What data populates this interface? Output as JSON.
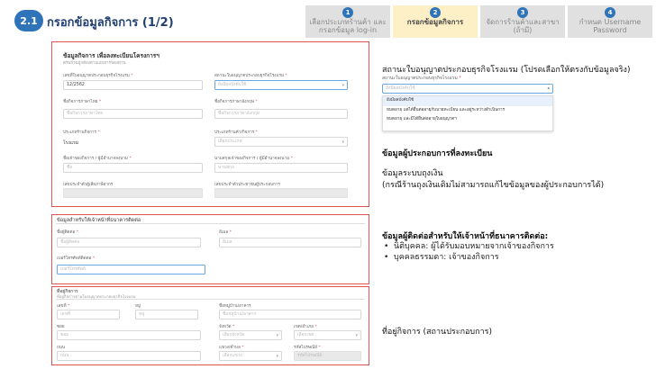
{
  "header": {
    "step_badge": "2.1",
    "title": "กรอกข้อมูลกิจการ (1/2)",
    "steps": [
      {
        "num": "1",
        "label": "เลือกประเภทร้านค้า และกรอกข้อมูล log-in"
      },
      {
        "num": "2",
        "label": "กรอกข้อมูลกิจการ"
      },
      {
        "num": "3",
        "label": "จัดการร้านค้าและสาขา (ถ้ามี)"
      },
      {
        "num": "4",
        "label": "กำหนด Username Password"
      }
    ]
  },
  "form_business": {
    "title": "ข้อมูลกิจการ เพื่อลงทะเบียนโครงการฯ",
    "subtitle": "ครบถ้วนถูกต้องตามเอกสารของท่าน",
    "field_license_no": {
      "label": "เลขที่ใบอนุญาตประกอบธุรกิจโรงแรม",
      "value": "12/2562"
    },
    "field_license_status": {
      "label": "สถานะใบอนุญาตประกอบธุรกิจโรงแรม",
      "placeholder": "ยังมีผลบังคับใช้"
    },
    "field_name_th": {
      "label": "ชื่อกิจการภาษาไทย",
      "placeholder": "ชื่อกิจการภาษาไทย"
    },
    "field_name_en": {
      "label": "ชื่อกิจการภาษาอังกฤษ",
      "placeholder": "ชื่อกิจการภาษาอังกฤษ"
    },
    "field_business_type": {
      "label": "ประเภทร้านกิจการ",
      "value": "โรงแรม"
    },
    "field_business_category": {
      "label": "ประเภทร้านค้า/กิจการ",
      "placeholder": "เลือกประเภท"
    },
    "field_owner_name": {
      "label": "ชื่อเจ้าของกิจการ / ผู้มีอำนาจลงนาม",
      "placeholder": "ชื่อ"
    },
    "field_owner_surname": {
      "label": "นามสกุลเจ้าของกิจการ / ผู้มีอำนาจลงนาม",
      "placeholder": "นามสกุล"
    },
    "field_tax_id": {
      "label": "เลขประจำตัวผู้เสียภาษีอากร",
      "placeholder": ""
    },
    "field_id_card": {
      "label": "เลขประจำตัวประชาชนผู้ประกอบการ",
      "placeholder": ""
    }
  },
  "form_contact": {
    "title": "ข้อมูลสำหรับให้เจ้าหน้าที่ธนาคารติดต่อ",
    "field_name": {
      "label": "ชื่อผู้ติดต่อ",
      "placeholder": "ชื่อผู้ติดต่อ"
    },
    "field_email": {
      "label": "อีเมล",
      "placeholder": "อีเมล"
    },
    "field_phone": {
      "label": "เบอร์โทรศัพท์ติดต่อ",
      "placeholder": "เบอร์โทรศัพท์"
    }
  },
  "form_address": {
    "title": "ที่อยู่กิจการ",
    "subtitle": "ที่อยู่กิจการตามใบอนุญาตประกอบธุรกิจโรงแรม",
    "field_house_no": {
      "label": "เลขที่",
      "placeholder": "เลขที่"
    },
    "field_moo": {
      "label": "หมู่",
      "placeholder": "หมู่"
    },
    "field_building": {
      "label": "ชื่อหมู่บ้าน/อาคาร",
      "placeholder": "ชื่อหมู่บ้าน/อาคาร"
    },
    "field_soi": {
      "label": "ซอย",
      "placeholder": "ซอย"
    },
    "field_province": {
      "label": "จังหวัด",
      "placeholder": "เลือกจังหวัด"
    },
    "field_district": {
      "label": "เขต/อำเภอ",
      "placeholder": "เลือกเขต"
    },
    "field_road": {
      "label": "ถนน",
      "placeholder": "ถนน"
    },
    "field_subdistrict": {
      "label": "แขวง/ตำบล",
      "placeholder": "เลือกแขวง"
    },
    "field_postcode": {
      "label": "รหัสไปรษณีย์",
      "placeholder": "รหัสไปรษณีย์"
    }
  },
  "annotations": {
    "license_status_title": "สถานะใบอนุญาตประกอบธุรกิจโรงแรม (โปรดเลือกให้ตรงกับข้อมูลจริง)",
    "dropdown_label": "สถานะใบอนุญาตประกอบธุรกิจโรงแรม",
    "dropdown_placeholder": "ยังมีผลบังคับใช้",
    "dropdown_options": [
      "ยังมีผลบังคับใช้",
      "หมดอายุ แต่ได้ยื่นต่ออายุกับนายทะเบียน และอยู่ระหว่างดำเนินการ",
      "หมดอายุ และมิได้ยื่นต่ออายุใบอนุญาตฯ"
    ],
    "registrant_title": "ข้อมูลผู้ประกอบการที่ลงทะเบียน",
    "wallet_line1": "ข้อมูลระบบถุงเงิน",
    "wallet_line2": "(กรณีร้านถุงเงินเดิมไม่สามารถแก้ไขข้อมูลของผู้ประกอบการได้)",
    "contact_title": "ข้อมูลผู้ติดต่อสำหรับให้เจ้าหน้าที่ธนาคารติดต่อ:",
    "contact_bullets": [
      "นิติบุคคล: ผู้ได้รับมอบหมายจากเจ้าของกิจการ",
      "บุคคลธรรมดา: เจ้าของกิจการ"
    ],
    "address_note": "ที่อยู่กิจการ (สถานประกอบการ)"
  },
  "colors": {
    "accent": "#2f73b9",
    "highlight_border": "#e15353",
    "active_step": "#fdf0c7"
  }
}
